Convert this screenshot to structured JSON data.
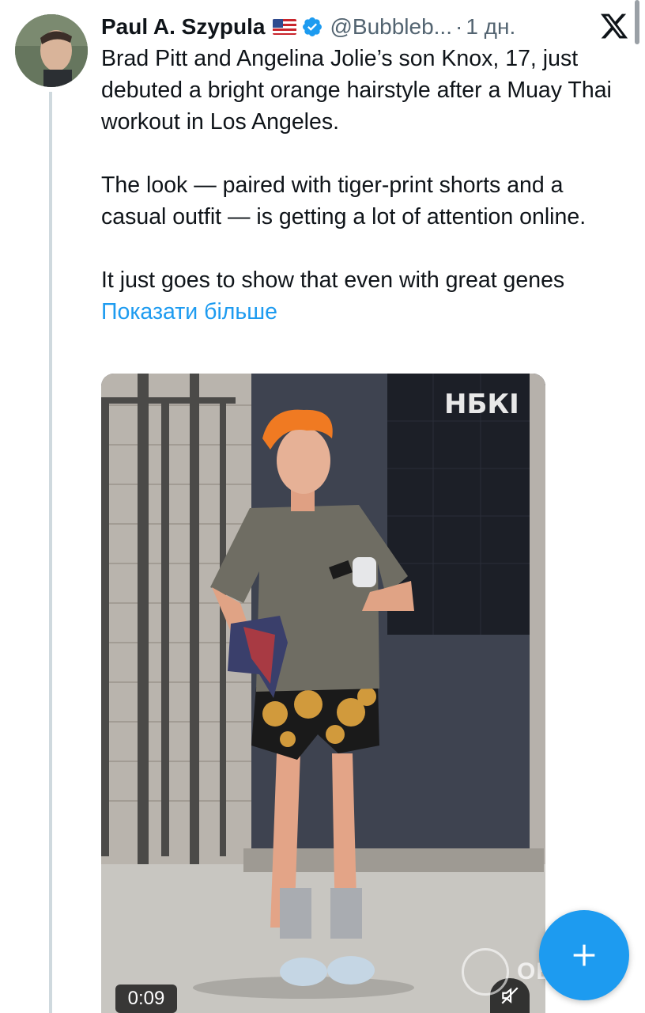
{
  "tweet": {
    "author_name": "Paul A. Szypula",
    "handle": "@Bubbleb...",
    "separator": "·",
    "time": "1 дн.",
    "paragraphs": [
      "Brad Pitt and Angelina Jolie’s son Knox, 17, just debuted a bright orange hairstyle after a Muay Thai workout in Los Angeles.",
      "The look — paired with tiger-print shorts and a casual outfit — is getting a lot of attention online."
    ],
    "last_paragraph": "It just goes to show that even with great genes",
    "show_more": "Показати більше"
  },
  "media": {
    "sign_text": "НБКІ",
    "timer": "0:09"
  },
  "watermark": "OBOZ.UA",
  "colors": {
    "accent": "#1d9bf0",
    "text": "#0f1419",
    "secondary": "#536471"
  },
  "icons": {
    "verified": "verified-badge-icon",
    "flag": "us-flag-icon",
    "close": "x-logo-icon",
    "mute": "muted-speaker-icon",
    "compose": "plus-icon"
  }
}
